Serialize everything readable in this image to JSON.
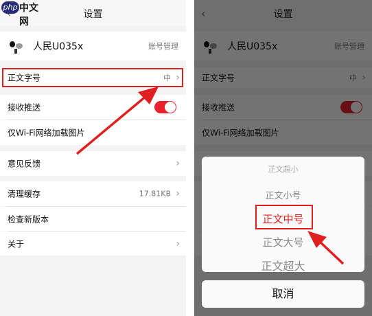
{
  "watermark": {
    "php": "php",
    "text": "中文网"
  },
  "header": {
    "back_icon": "‹",
    "title": "设置"
  },
  "account": {
    "username": "人民U035x",
    "action": "账号管理"
  },
  "settings": {
    "font_size": {
      "label": "正文字号",
      "value": "中"
    },
    "push": {
      "label": "接收推送",
      "enabled": true
    },
    "wifi_images": {
      "label": "仅Wi-Fi网络加载图片"
    },
    "feedback": {
      "label": "意见反馈"
    },
    "cache": {
      "label": "清理缓存",
      "value": "17.81KB"
    },
    "update": {
      "label": "检查新版本"
    },
    "about": {
      "label": "关于"
    }
  },
  "chevron": "›",
  "picker": {
    "options": [
      "正文超小",
      "正文小号",
      "正文中号",
      "正文大号",
      "正文超大"
    ],
    "selected": "正文中号",
    "cancel": "取消"
  },
  "colors": {
    "accent": "#e8212a",
    "highlight": "#e02020"
  }
}
